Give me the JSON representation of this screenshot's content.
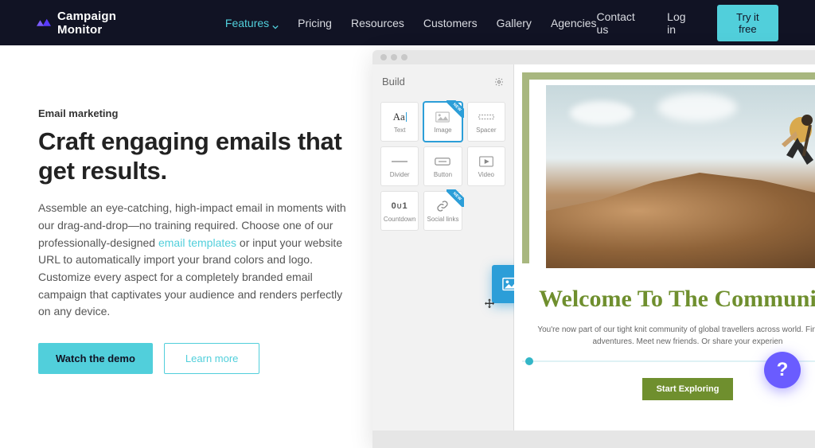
{
  "brand": {
    "name": "Campaign Monitor"
  },
  "nav": {
    "links": [
      "Features",
      "Pricing",
      "Resources",
      "Customers",
      "Gallery",
      "Agencies"
    ],
    "active": "Features",
    "right": {
      "contact": "Contact us",
      "login": "Log in",
      "cta": "Try it free"
    }
  },
  "hero": {
    "eyebrow": "Email marketing",
    "headline": "Craft engaging emails that get results.",
    "body_pre": "Assemble an eye-catching, high-impact email in moments with our drag-and-drop—no training required. Choose one of our professionally-designed ",
    "body_link": "email templates",
    "body_post": " or input your website URL to automatically import your brand colors and logo. Customize every aspect for a completely branded email campaign that captivates your audience and renders perfectly on any device.",
    "primary_cta": "Watch the demo",
    "secondary_cta": "Learn more"
  },
  "builder": {
    "panel_title": "Build",
    "blocks": [
      {
        "label": "Text",
        "icon": "text"
      },
      {
        "label": "Image",
        "icon": "image",
        "new": true,
        "selected": true
      },
      {
        "label": "Spacer",
        "icon": "spacer"
      },
      {
        "label": "Divider",
        "icon": "divider"
      },
      {
        "label": "Button",
        "icon": "button"
      },
      {
        "label": "Video",
        "icon": "video"
      },
      {
        "label": "Countdown",
        "icon": "countdown"
      },
      {
        "label": "Social links",
        "icon": "social",
        "new": true
      }
    ]
  },
  "canvas": {
    "headline": "Welcome To The Community",
    "body": "You're now part of our tight knit community of global travellers across world. Find new adventures. Meet new friends. Or share your experien",
    "cta": "Start Exploring"
  },
  "help": {
    "label": "?"
  }
}
